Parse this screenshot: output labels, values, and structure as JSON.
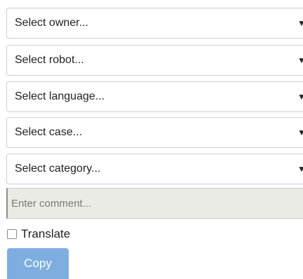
{
  "selects": {
    "owner": {
      "placeholder": "Select owner..."
    },
    "robot": {
      "placeholder": "Select robot..."
    },
    "language": {
      "placeholder": "Select language..."
    },
    "case": {
      "placeholder": "Select case..."
    },
    "category": {
      "placeholder": "Select category..."
    },
    "caret_glyph": "▼"
  },
  "comment": {
    "placeholder": "Enter comment...",
    "value": ""
  },
  "translate": {
    "label": "Translate",
    "checked": false
  },
  "copy_button": {
    "label": "Copy",
    "color": "#7eaee0"
  }
}
